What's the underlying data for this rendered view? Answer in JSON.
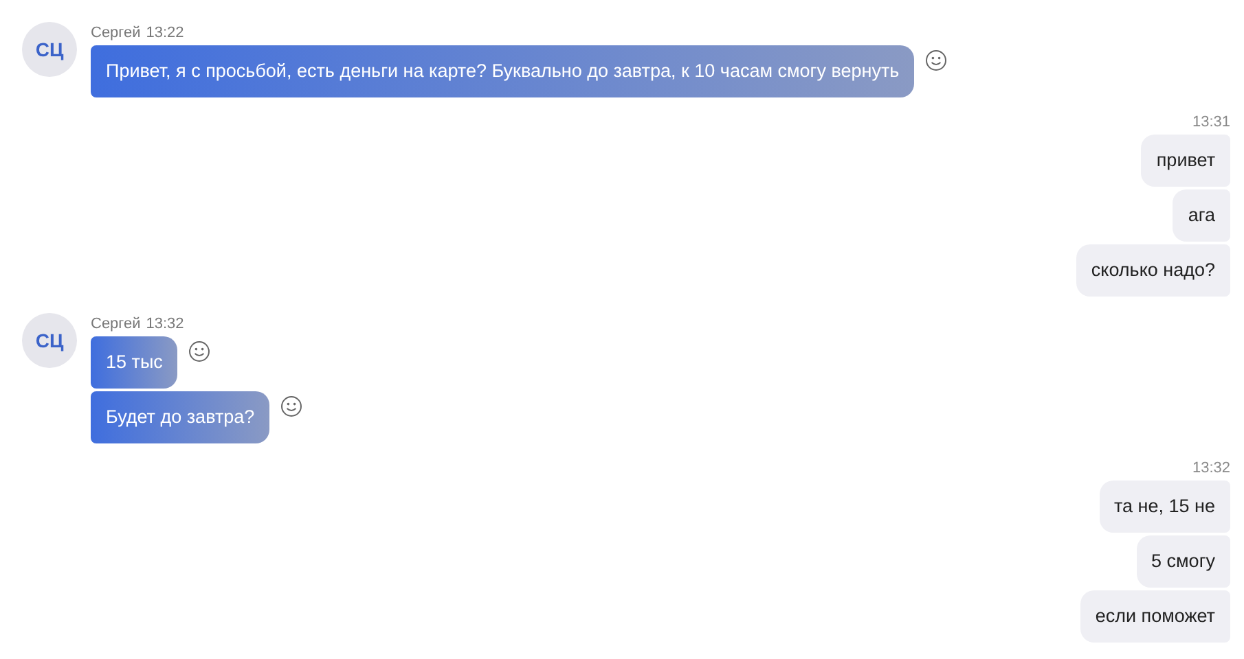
{
  "groups": [
    {
      "kind": "incoming",
      "avatar": "СЦ",
      "sender": "Сергей",
      "time": "13:22",
      "messages": [
        "Привет, я с просьбой, есть деньги на карте? Буквально до завтра, к 10 часам смогу вернуть"
      ]
    },
    {
      "kind": "outgoing",
      "time": "13:31",
      "messages": [
        "привет",
        "ага",
        "сколько надо?"
      ]
    },
    {
      "kind": "incoming",
      "avatar": "СЦ",
      "sender": "Сергей",
      "time": "13:32",
      "messages": [
        "15 тыс",
        "Будет до завтра?"
      ]
    },
    {
      "kind": "outgoing",
      "time": "13:32",
      "messages": [
        "та не, 15 не",
        "5 смогу",
        "если поможет"
      ]
    }
  ]
}
